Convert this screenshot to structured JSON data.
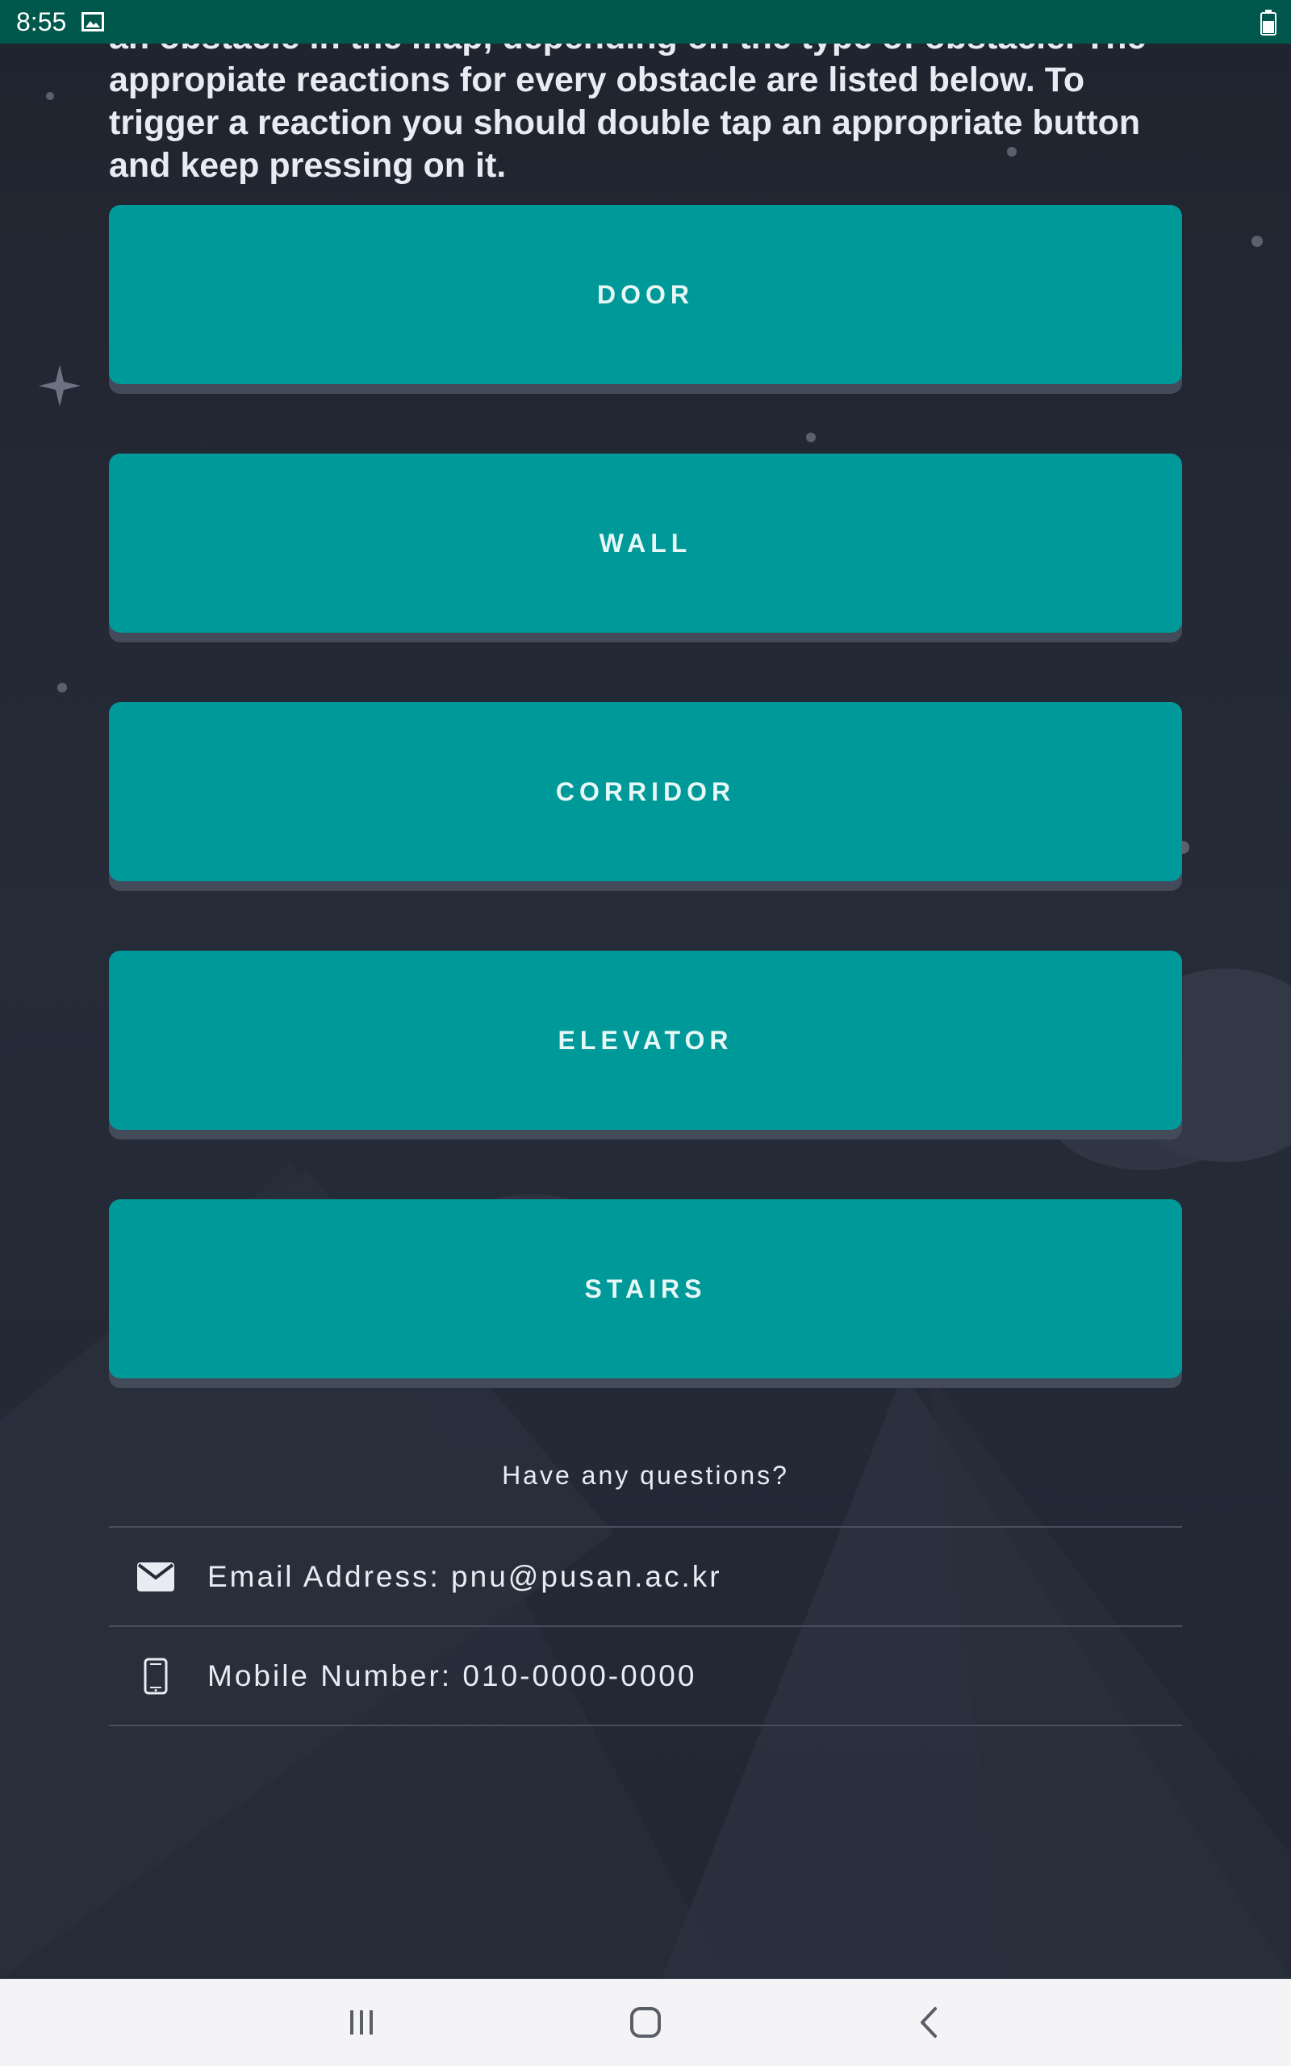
{
  "status_bar": {
    "time": "8:55",
    "icons": [
      "image-icon",
      "battery-icon"
    ]
  },
  "intro": {
    "text": "an obstacle in the map, depending on the type of obstacle. The appropiate reactions for every obstacle are listed below. To trigger a reaction you should double tap an appropriate button and keep pressing on it."
  },
  "obstacles": [
    {
      "label": "DOOR"
    },
    {
      "label": "WALL"
    },
    {
      "label": "CORRIDOR"
    },
    {
      "label": "ELEVATOR"
    },
    {
      "label": "STAIRS"
    }
  ],
  "contact": {
    "title": "Have any questions?",
    "email": {
      "icon": "envelope-icon",
      "text": "Email Address: pnu@pusan.ac.kr"
    },
    "mobile": {
      "icon": "mobile-phone-icon",
      "text": "Mobile Number: 010-0000-0000"
    }
  },
  "nav_bar": {
    "buttons": [
      "recent-apps-icon",
      "home-icon",
      "back-icon"
    ]
  },
  "colors": {
    "status_bar": "#00574b",
    "background": "#232733",
    "button": "#009999",
    "button_shadow": "#434a5a",
    "text": "#e8ebf2",
    "nav_bar": "#f4f4f6"
  }
}
